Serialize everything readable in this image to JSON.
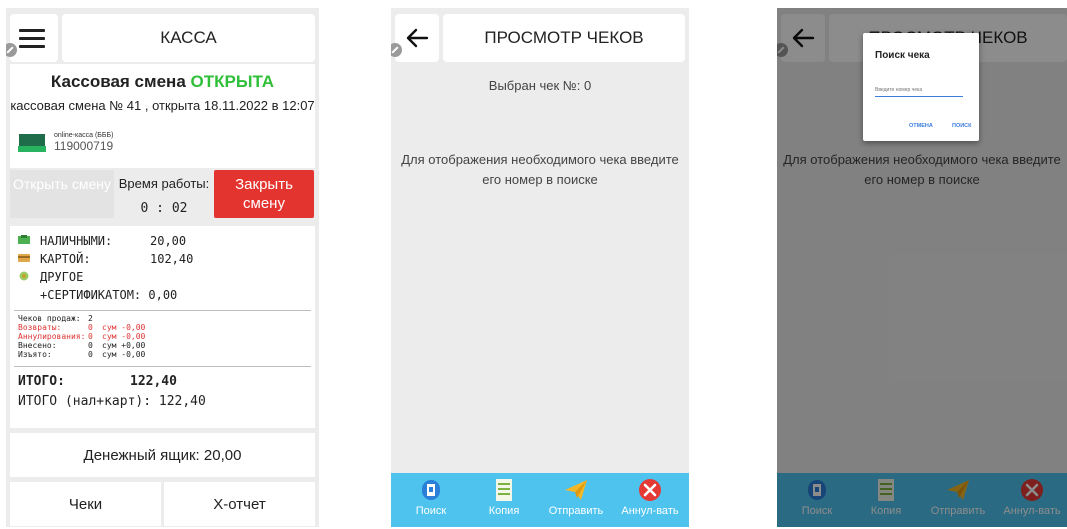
{
  "screen1": {
    "title": "КАССА",
    "shift_label": "Кассовая смена",
    "shift_state": "ОТКРЫТА",
    "shift_info": "кассовая смена № 41 , открыта 18.11.2022 в 12:07",
    "device_name": "online-касса (БББ)",
    "device_number": "119000719",
    "open_button": "Открыть смену",
    "worktime_label": "Время работы:",
    "worktime_value": "0 : 02",
    "close_button": "Закрыть смену",
    "payments": [
      {
        "label": "НАЛИЧНЫМИ:",
        "value": "20,00",
        "icon": "cash-icon",
        "color": "#4caf50"
      },
      {
        "label": "КАРТОЙ:",
        "value": "102,40",
        "icon": "card-icon",
        "color": "#e0a74a"
      },
      {
        "label": "ДРУГОЕ",
        "value": "",
        "icon": "other-icon",
        "color": "#9ccc65"
      }
    ],
    "certificate": "+СЕРТИФИКАТОМ: 0,00",
    "counts": [
      {
        "label": "Чеков продаж:",
        "count": "2",
        "sum": ""
      },
      {
        "label": "Возвраты:",
        "count": "0",
        "sum": "сум -0,00"
      },
      {
        "label": "Аннулирования:",
        "count": "0",
        "sum": "сум -0,00"
      },
      {
        "label": "Внесено:",
        "count": "0",
        "sum": "сум +0,00"
      },
      {
        "label": "Изъято:",
        "count": "0",
        "sum": "сум -0,00"
      }
    ],
    "total_label": "ИТОГО:",
    "total_value": "122,40",
    "total_cash_card": "ИТОГО (нал+карт): 122,40",
    "cash_drawer": "Денежный ящик: 20,00",
    "checks_button": "Чеки",
    "x_report_button": "X-отчет"
  },
  "screen2": {
    "title": "ПРОСМОТР ЧЕКОВ",
    "selected_check": "Выбран чек №: 0",
    "hint": "Для отображения необходимого чека введите его номер в поиске",
    "toolbar": [
      "Поиск",
      "Копия",
      "Отправить",
      "Аннул-вать"
    ]
  },
  "screen3": {
    "title": "ПРОСМОТР ЧЕКОВ",
    "hint": "Для отображения необходимого чека введите его номер в поиске",
    "dialog_title": "Поиск чека",
    "dialog_placeholder": "Введите номер чека",
    "dialog_cancel": "ОТМЕНА",
    "dialog_search": "ПОИСК",
    "toolbar": [
      "Поиск",
      "Копия",
      "Отправить",
      "Аннул-вать"
    ]
  },
  "colors": {
    "accent_green": "#2fbf39",
    "close_red": "#e3342f",
    "toolbar_blue": "#4ec3ee",
    "link_blue": "#3b7ddd"
  }
}
